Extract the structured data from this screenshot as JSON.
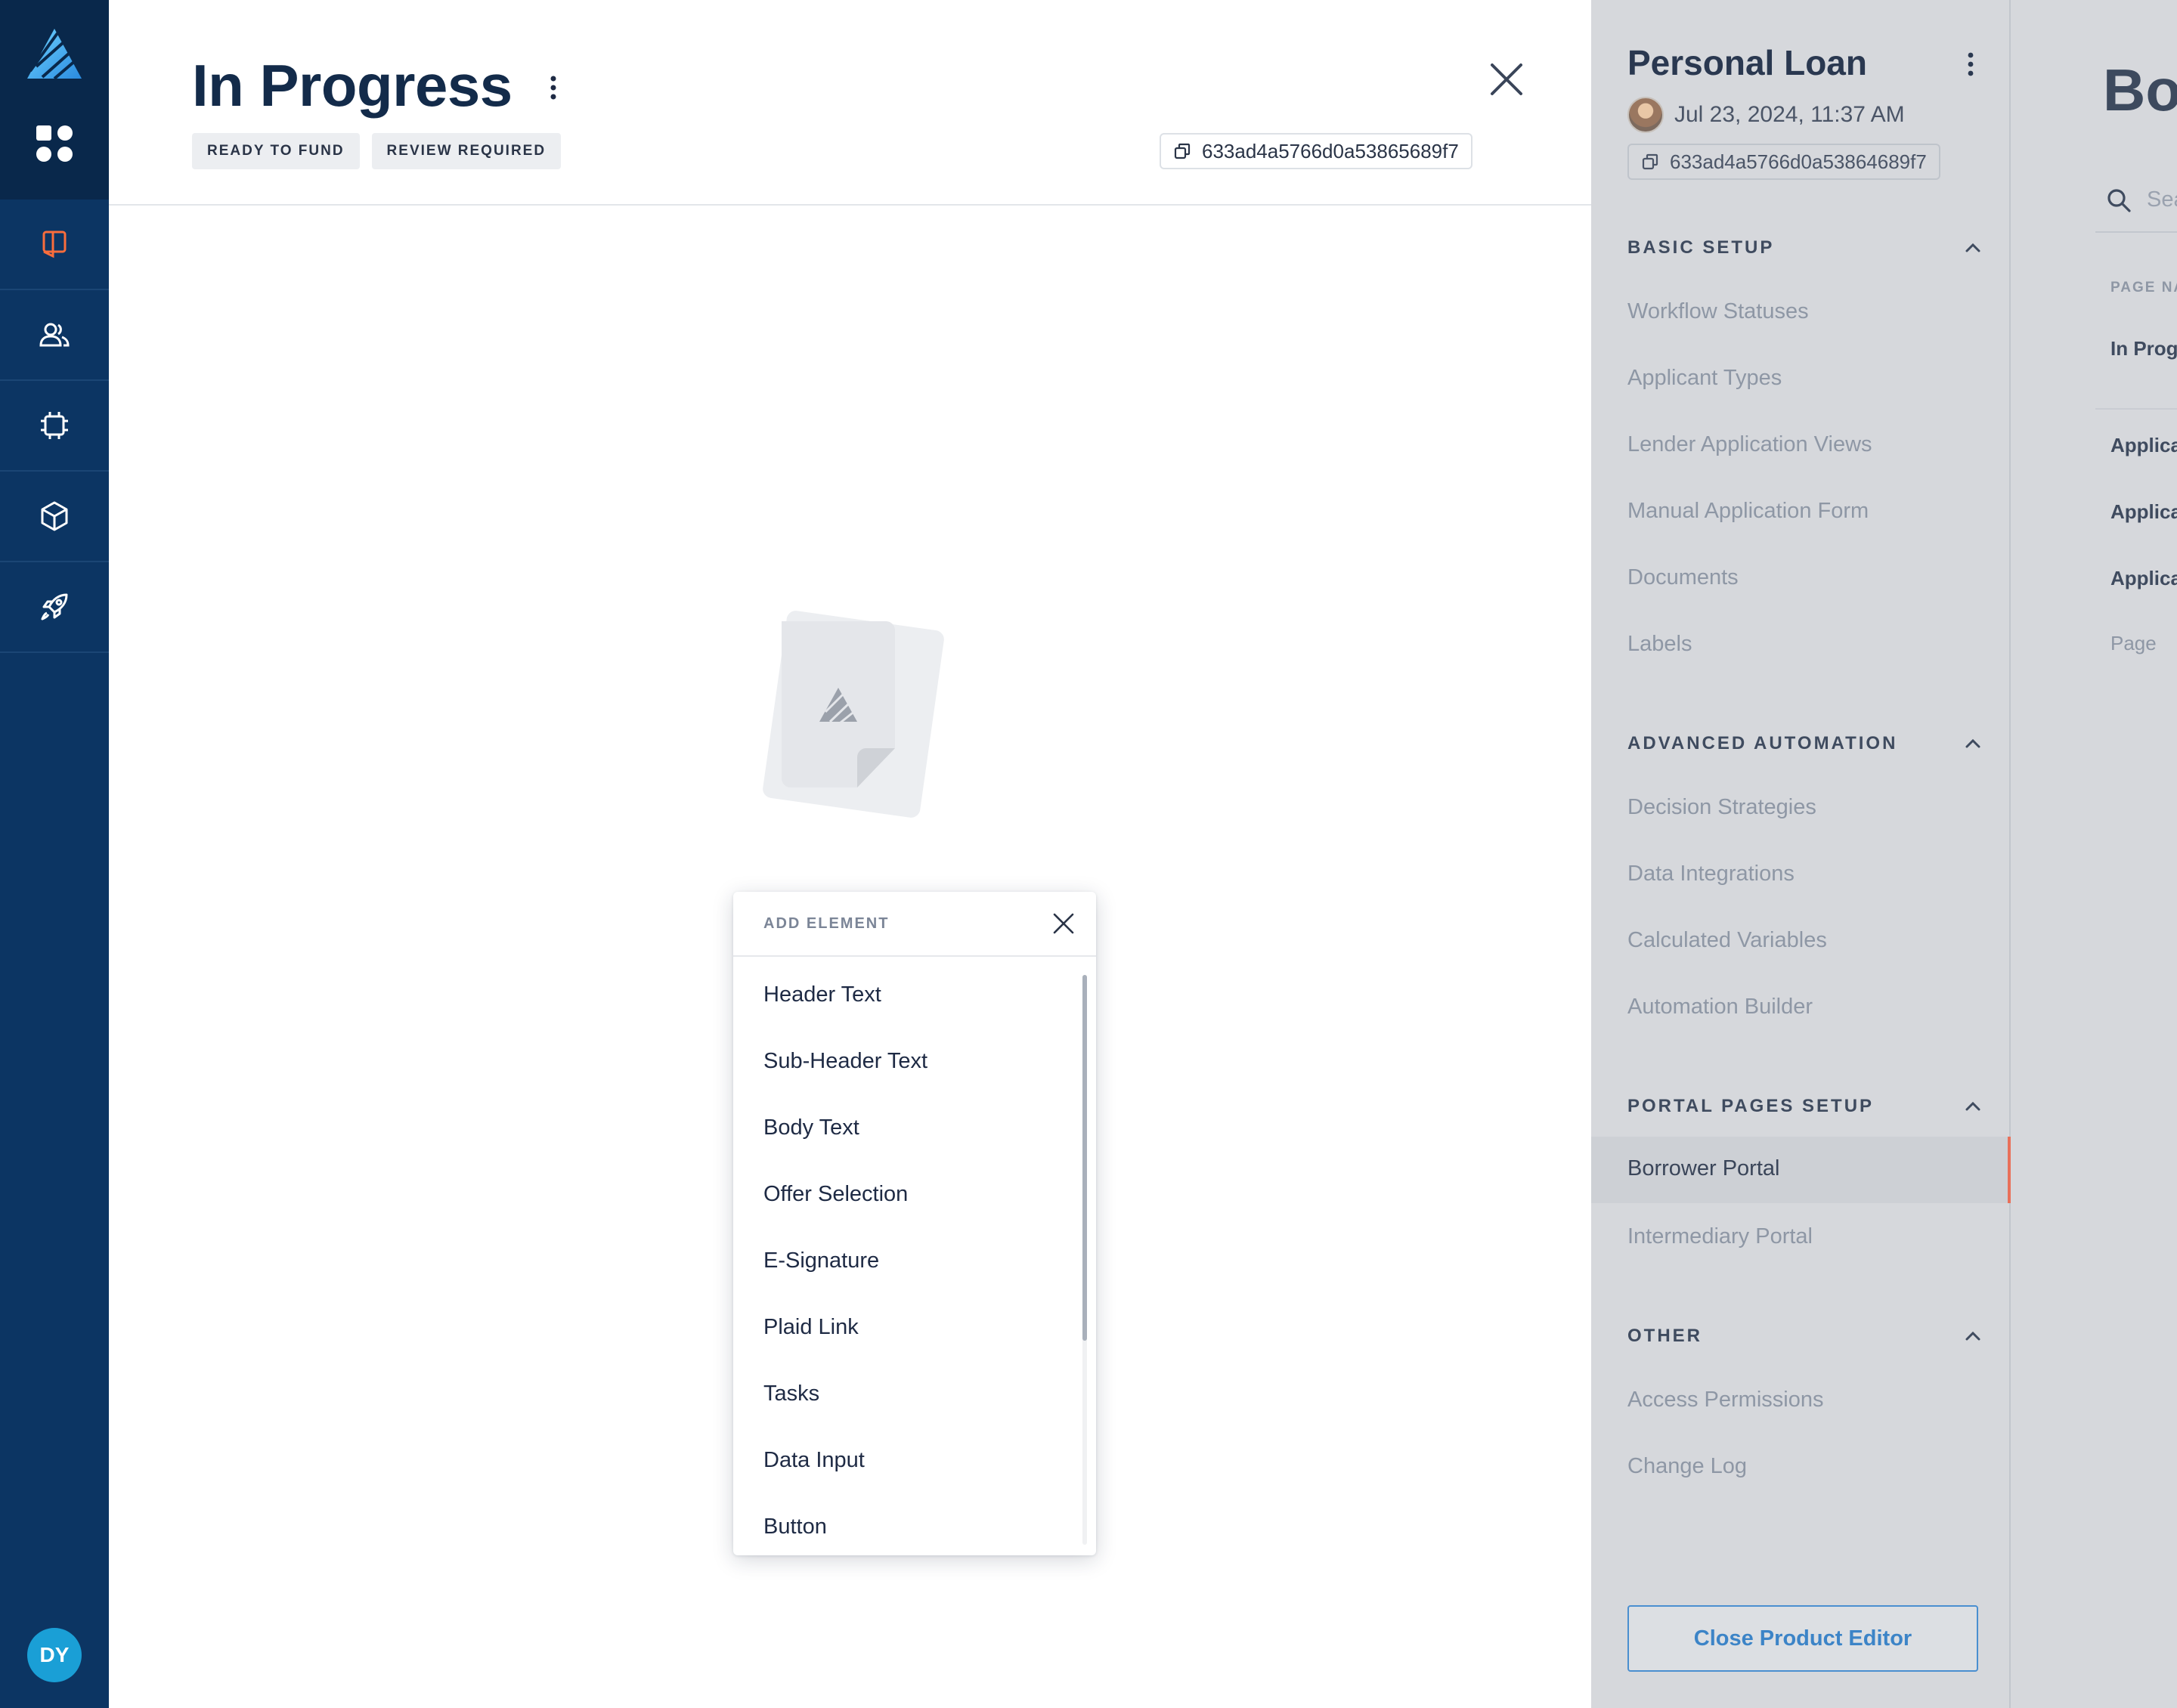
{
  "rail": {
    "avatar_initials": "DY",
    "items": [
      "book-icon",
      "people-icon",
      "chip-icon",
      "cube-icon",
      "rocket-icon"
    ]
  },
  "main": {
    "title": "In Progress",
    "tags": [
      "READY TO FUND",
      "REVIEW REQUIRED"
    ],
    "id": "633ad4a5766d0a53865689f7"
  },
  "add_element": {
    "title": "ADD ELEMENT",
    "items": [
      "Header Text",
      "Sub-Header Text",
      "Body Text",
      "Offer Selection",
      "E-Signature",
      "Plaid Link",
      "Tasks",
      "Data Input",
      "Button"
    ]
  },
  "product_editor": {
    "title": "Personal Loan",
    "date": "Jul 23, 2024, 11:37 AM",
    "id": "633ad4a5766d0a53864689f7",
    "sections": [
      {
        "title": "BASIC SETUP",
        "items": [
          "Workflow Statuses",
          "Applicant Types",
          "Lender Application Views",
          "Manual Application Form",
          "Documents",
          "Labels"
        ]
      },
      {
        "title": "ADVANCED AUTOMATION",
        "items": [
          "Decision Strategies",
          "Data Integrations",
          "Calculated Variables",
          "Automation Builder"
        ]
      },
      {
        "title": "PORTAL PAGES SETUP",
        "items": [
          "Borrower Portal",
          "Intermediary Portal"
        ]
      },
      {
        "title": "OTHER",
        "items": [
          "Access Permissions",
          "Change Log"
        ]
      }
    ],
    "active_item": "Borrower Portal",
    "close_button": "Close Product Editor"
  },
  "behind_panel": {
    "title": "Bo",
    "search_placeholder": "Sea",
    "column_header": "PAGE NA",
    "rows": [
      "In Prog",
      "Applica",
      "Applica",
      "Applica"
    ],
    "footer_text": "Page"
  },
  "colors": {
    "rail": "#0c3563",
    "accent_orange": "#f96d3c",
    "link_blue": "#3c84c7"
  }
}
